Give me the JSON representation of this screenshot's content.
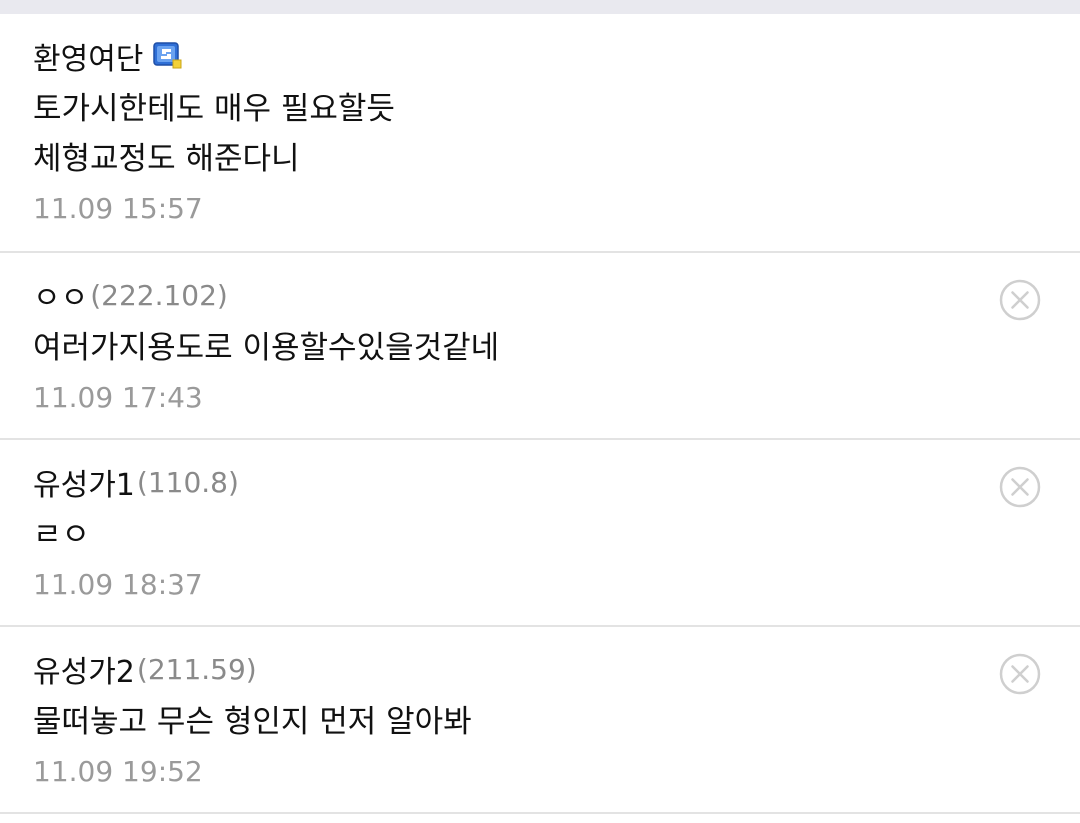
{
  "comments": [
    {
      "author": "환영여단",
      "ip": "",
      "lines": [
        "토가시한테도 매우 필요할듯",
        "체형교정도 해준다니"
      ],
      "time": "11.09 15:57",
      "badge_icon": "gallery-manager-badge-icon",
      "delete": false
    },
    {
      "author": "ㅇㅇ",
      "ip": "(222.102)",
      "lines": [
        "여러가지용도로 이용할수있을것같네"
      ],
      "time": "11.09 17:43",
      "delete_icon": "close-circle-icon",
      "delete": true
    },
    {
      "author": "유성가1",
      "ip": "(110.8)",
      "lines": [
        "ㄹㅇ"
      ],
      "time": "11.09 18:37",
      "delete_icon": "close-circle-icon",
      "delete": true
    },
    {
      "author": "유성가2",
      "ip": "(211.59)",
      "lines": [
        "물떠놓고 무슨 형인지 먼저 알아봐"
      ],
      "time": "11.09 19:52",
      "delete_icon": "close-circle-icon",
      "delete": true
    }
  ],
  "colors": {
    "divider": "#e3e3e3",
    "meta_text": "#9a9a9a",
    "top_bar": "#e9e9ef",
    "badge_blue": "#2f6fd6",
    "badge_yellow": "#f2d13a"
  }
}
